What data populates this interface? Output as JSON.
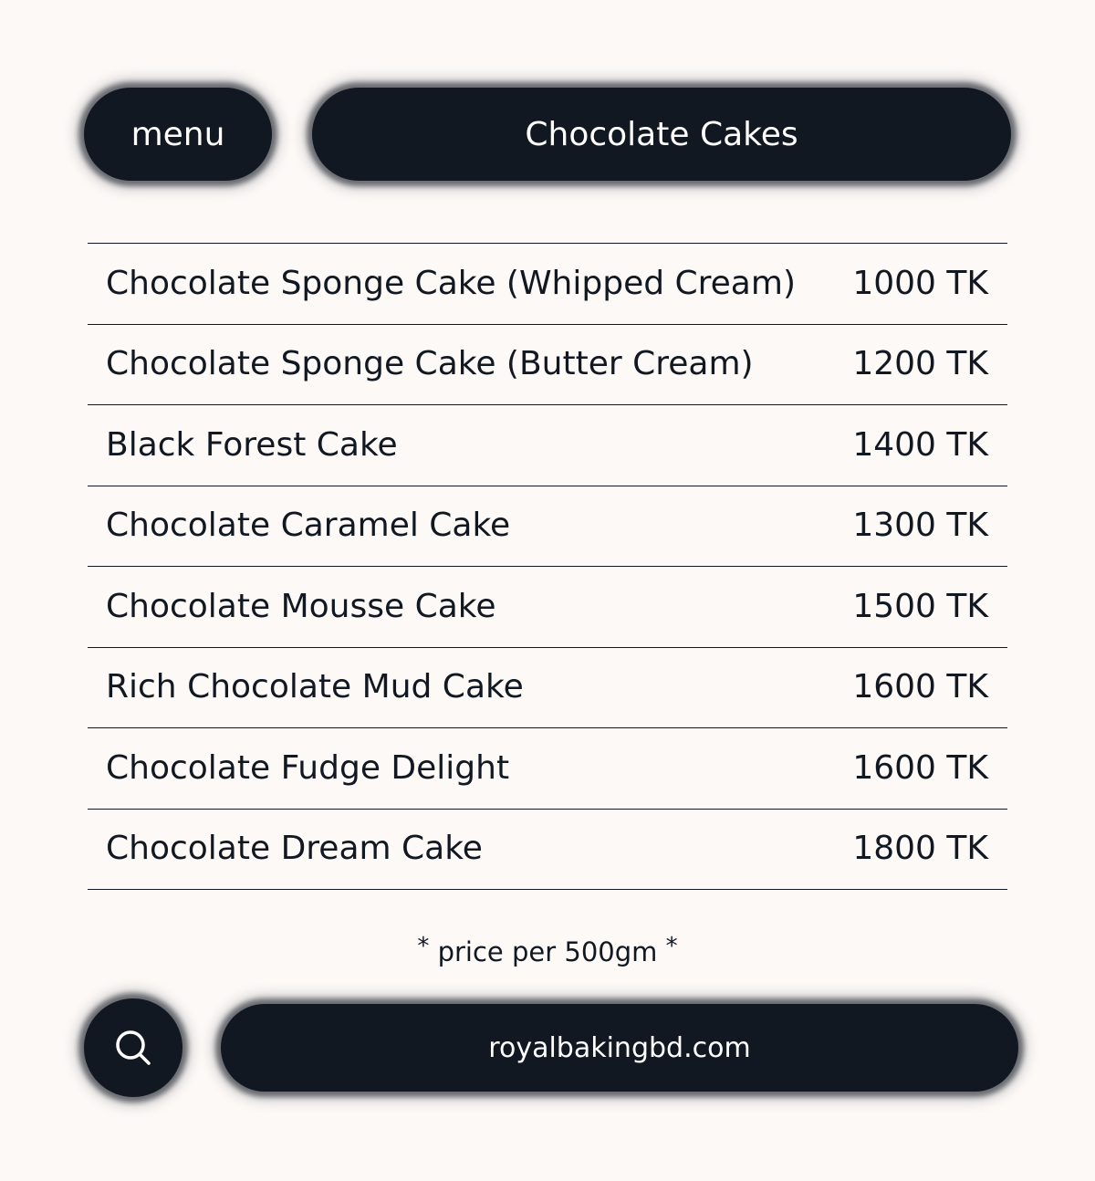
{
  "header": {
    "menu_label": "menu",
    "title": "Chocolate Cakes"
  },
  "items": [
    {
      "name": "Chocolate Sponge Cake (Whipped Cream)",
      "price": "1000 TK"
    },
    {
      "name": "Chocolate Sponge Cake (Butter Cream)",
      "price": "1200 TK"
    },
    {
      "name": "Black Forest Cake",
      "price": "1400 TK"
    },
    {
      "name": "Chocolate Caramel Cake",
      "price": "1300 TK"
    },
    {
      "name": "Chocolate Mousse Cake",
      "price": "1500 TK"
    },
    {
      "name": "Rich Chocolate Mud Cake",
      "price": "1600 TK"
    },
    {
      "name": "Chocolate Fudge Delight",
      "price": "1600 TK"
    },
    {
      "name": "Chocolate Dream Cake",
      "price": "1800 TK"
    }
  ],
  "note": {
    "star": "*",
    "text": "price per 500gm"
  },
  "footer": {
    "search_icon": "search-icon",
    "website": "royalbakingbd.com"
  },
  "colors": {
    "background": "#fcf9f7",
    "pill": "#121821",
    "text": "#111821"
  }
}
